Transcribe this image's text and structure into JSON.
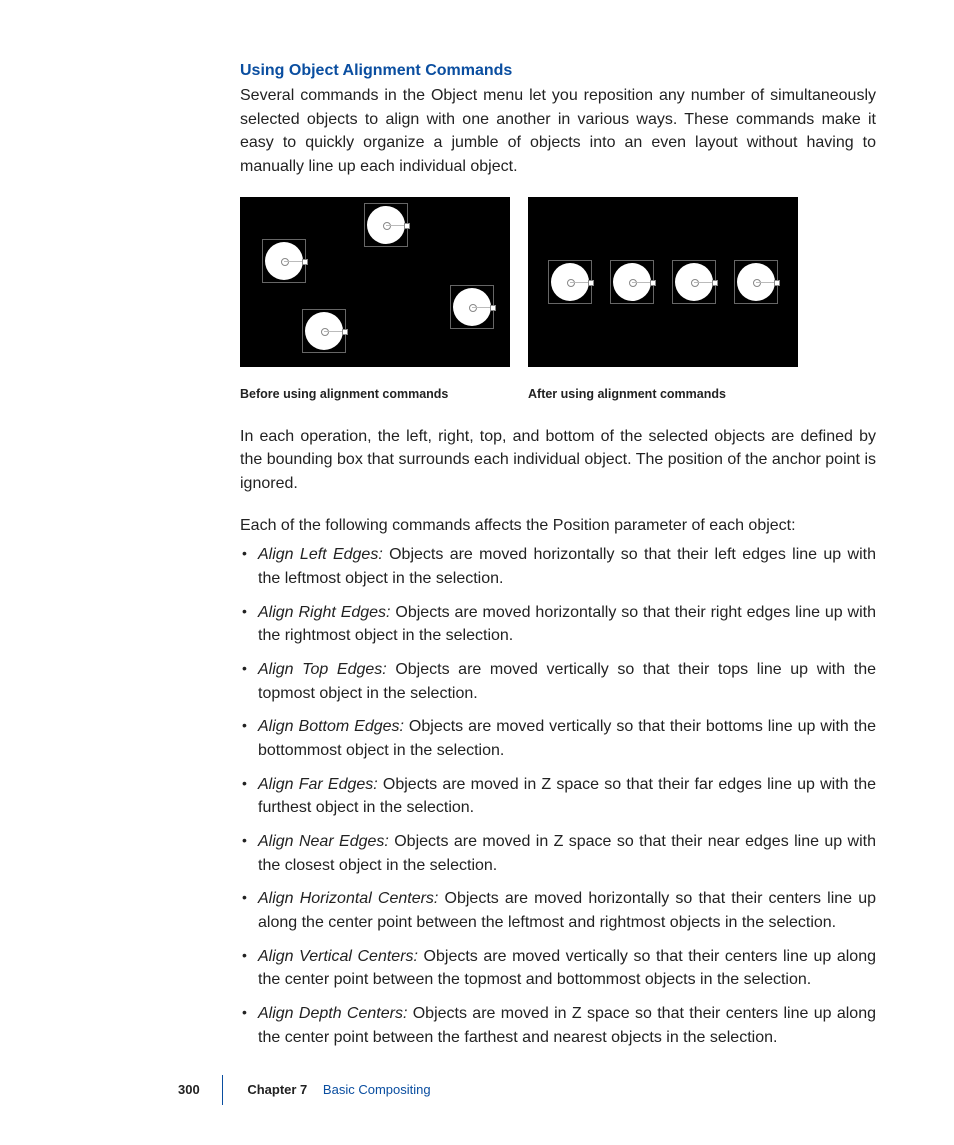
{
  "section_title": "Using Object Alignment Commands",
  "intro": "Several commands in the Object menu let you reposition any number of simultaneously selected objects to align with one another in various ways. These commands make it easy to quickly organize a jumble of objects into an even layout without having to manually line up each individual object.",
  "caption_before": "Before using alignment commands",
  "caption_after": "After using alignment commands",
  "para_bbox": "In each operation, the left, right, top, and bottom of the selected objects are defined by the bounding box that surrounds each individual object. The position of the anchor point is ignored.",
  "para_effect": "Each of the following commands affects the Position parameter of each object:",
  "items": [
    {
      "term": "Align Left Edges:",
      "desc": "  Objects are moved horizontally so that their left edges line up with the leftmost object in the selection."
    },
    {
      "term": "Align Right Edges:",
      "desc": "  Objects are moved horizontally so that their right edges line up with the rightmost object in the selection."
    },
    {
      "term": "Align Top Edges:",
      "desc": "  Objects are moved vertically so that their tops line up with the topmost object in the selection."
    },
    {
      "term": "Align Bottom Edges:",
      "desc": "  Objects are moved vertically so that their bottoms line up with the bottommost object in the selection."
    },
    {
      "term": "Align Far Edges:",
      "desc": "  Objects are moved in Z space so that their far edges line up with the furthest object in the selection."
    },
    {
      "term": "Align Near Edges:",
      "desc": "  Objects are moved in Z space so that their near edges line up with the closest object in the selection."
    },
    {
      "term": "Align Horizontal Centers:",
      "desc": "  Objects are moved horizontally so that their centers line up along the center point between the leftmost and rightmost objects in the selection."
    },
    {
      "term": "Align Vertical Centers:",
      "desc": "  Objects are moved vertically so that their centers line up along the center point between the topmost and bottommost objects in the selection."
    },
    {
      "term": "Align Depth Centers:",
      "desc": "  Objects are moved in Z space so that their centers line up along the center point between the farthest and nearest objects in the selection."
    }
  ],
  "footer": {
    "page": "300",
    "chapter": "Chapter 7",
    "title": "Basic Compositing"
  }
}
